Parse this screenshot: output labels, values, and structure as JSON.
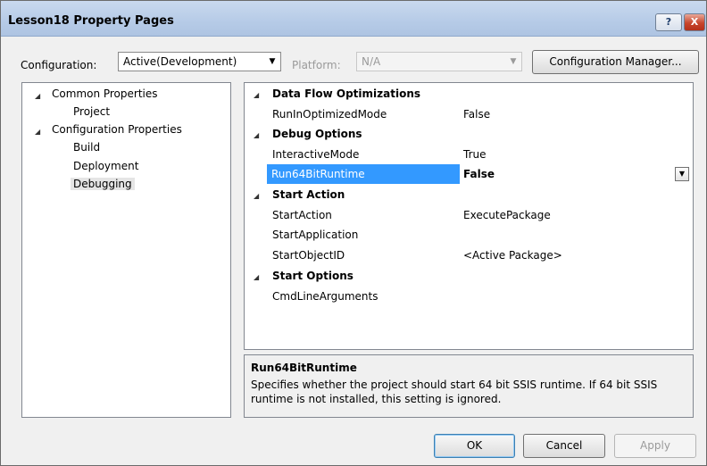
{
  "window": {
    "title": "Lesson18 Property Pages",
    "help_label": "?",
    "close_label": "X"
  },
  "config_bar": {
    "configuration_label": "Configuration:",
    "configuration_value": "Active(Development)",
    "platform_label": "Platform:",
    "platform_value": "N/A",
    "manager_button": "Configuration Manager..."
  },
  "tree": {
    "common_properties": "Common Properties",
    "project": "Project",
    "configuration_properties": "Configuration Properties",
    "build": "Build",
    "deployment": "Deployment",
    "debugging": "Debugging",
    "selected": "Debugging"
  },
  "grid": {
    "rows": [
      {
        "kind": "category",
        "name": "Data Flow Optimizations"
      },
      {
        "kind": "property",
        "name": "RunInOptimizedMode",
        "value": "False"
      },
      {
        "kind": "category",
        "name": "Debug Options"
      },
      {
        "kind": "property",
        "name": "InteractiveMode",
        "value": "True"
      },
      {
        "kind": "property",
        "name": "Run64BitRuntime",
        "value": "False",
        "selected": true
      },
      {
        "kind": "category",
        "name": "Start Action"
      },
      {
        "kind": "property",
        "name": "StartAction",
        "value": "ExecutePackage"
      },
      {
        "kind": "property",
        "name": "StartApplication",
        "value": ""
      },
      {
        "kind": "property",
        "name": "StartObjectID",
        "value": "<Active Package>"
      },
      {
        "kind": "category",
        "name": "Start Options"
      },
      {
        "kind": "property",
        "name": "CmdLineArguments",
        "value": ""
      }
    ]
  },
  "description": {
    "title": "Run64BitRuntime",
    "text": "Specifies whether the project should start 64 bit SSIS runtime. If 64 bit SSIS runtime is not installed, this setting is ignored."
  },
  "buttons": {
    "ok": "OK",
    "cancel": "Cancel",
    "apply": "Apply"
  },
  "colors": {
    "selection": "#3399ff",
    "titlebar": "#b6cbe7",
    "close_button": "#c7452c"
  },
  "icons": {
    "expanded": "collapse-triangle-icon",
    "dropdown": "chevron-down-icon"
  }
}
